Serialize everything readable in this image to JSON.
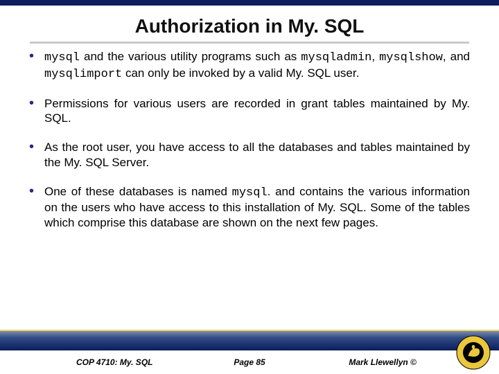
{
  "title": "Authorization in My. SQL",
  "bullets": [
    {
      "parts": [
        {
          "t": "mysql",
          "mono": true
        },
        {
          "t": " and the various utility programs such as "
        },
        {
          "t": "mysqladmin",
          "mono": true
        },
        {
          "t": ", "
        },
        {
          "t": "mysqlshow",
          "mono": true
        },
        {
          "t": ", and "
        },
        {
          "t": "mysqlimport",
          "mono": true
        },
        {
          "t": " can only be invoked by a valid My. SQL user."
        }
      ]
    },
    {
      "parts": [
        {
          "t": "Permissions for various users are recorded in grant tables maintained by My. SQL."
        }
      ]
    },
    {
      "parts": [
        {
          "t": "As the root user, you have access to all the databases and tables maintained by the My. SQL Server."
        }
      ]
    },
    {
      "parts": [
        {
          "t": "One of these databases is named "
        },
        {
          "t": "mysql",
          "mono": true
        },
        {
          "t": ". and contains the various information on the users who have access to this installation of My. SQL.  Some of the tables which comprise this database are shown on the next few pages."
        }
      ]
    }
  ],
  "footer": {
    "course": "COP 4710: My. SQL",
    "page": "Page 85",
    "author": "Mark Llewellyn ©"
  }
}
